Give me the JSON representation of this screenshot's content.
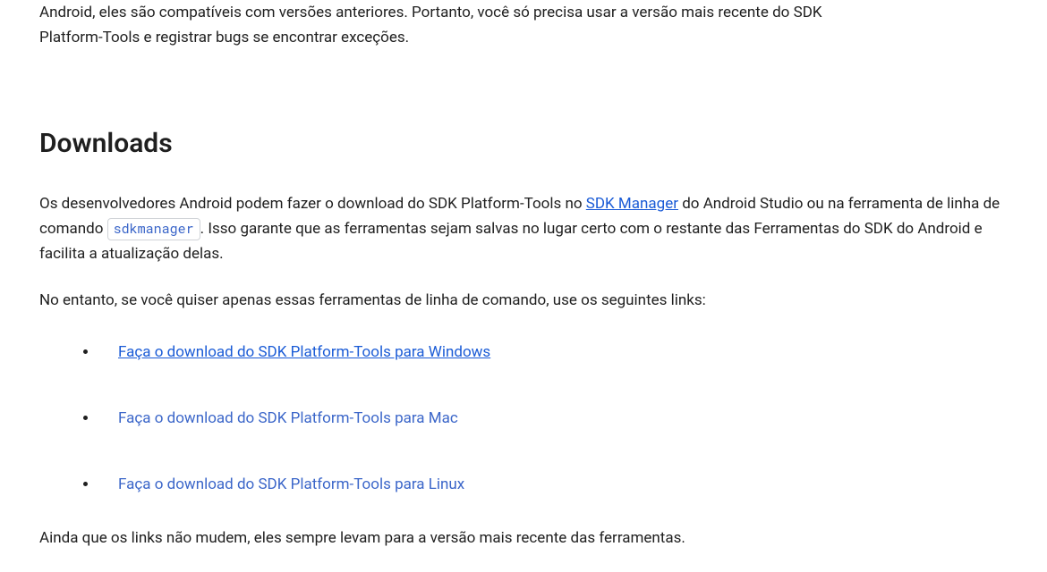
{
  "intro_fragment_line1": "Android, eles são compatíveis com versões anteriores. Portanto, você só precisa usar a versão mais recente do SDK",
  "intro_fragment_line2": "Platform-Tools e registrar bugs se encontrar exceções.",
  "downloads": {
    "heading": "Downloads",
    "para1_pre": "Os desenvolvedores Android podem fazer o download do SDK Platform-Tools no ",
    "para1_link": "SDK Manager",
    "para1_mid": " do Android Studio ou na ferramenta de linha de comando ",
    "para1_code": "sdkmanager",
    "para1_post": ". Isso garante que as ferramentas sejam salvas no lugar certo com o restante das Ferramentas do SDK do Android e facilita a atualização delas.",
    "para2": "No entanto, se você quiser apenas essas ferramentas de linha de comando, use os seguintes links:",
    "links": {
      "windows": "Faça o download do SDK Platform-Tools para Windows",
      "mac": "Faça o download do SDK Platform-Tools para Mac",
      "linux": "Faça o download do SDK Platform-Tools para Linux"
    },
    "footer": "Ainda que os links não mudem, eles sempre levam para a versão mais recente das ferramentas."
  }
}
